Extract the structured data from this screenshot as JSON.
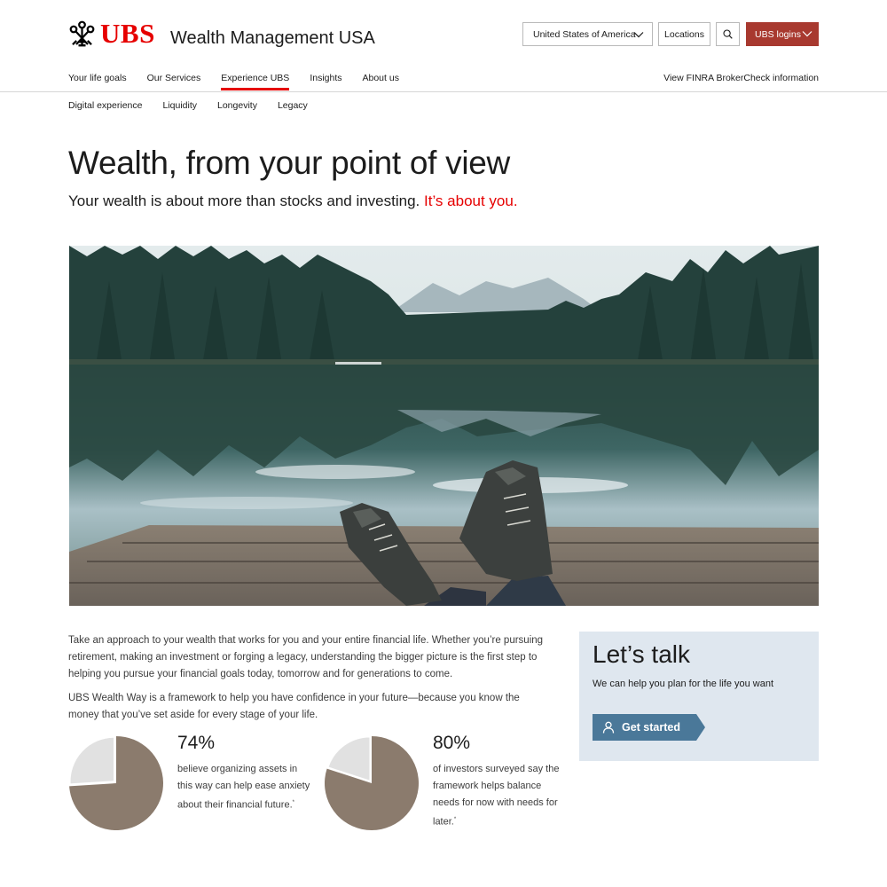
{
  "header": {
    "brand": "UBS",
    "site_title": "Wealth Management USA",
    "country_select": "United States of America",
    "locations_label": "Locations",
    "logins_label": "UBS logins",
    "search_icon": "search-icon"
  },
  "main_nav": {
    "items": [
      "Your life goals",
      "Our Services",
      "Experience UBS",
      "Insights",
      "About us"
    ],
    "active": "Experience UBS",
    "finra_link": "View FINRA BrokerCheck information"
  },
  "sub_nav": {
    "items": [
      "Digital experience",
      "Liquidity",
      "Longevity",
      "Legacy"
    ]
  },
  "hero": {
    "title": "Wealth, from your point of view",
    "subtitle": "Your wealth is about more than stocks and investing.",
    "subtitle_accent": "It’s about you."
  },
  "intro": {
    "paragraph_1": "Take an approach to your wealth that works for you and your entire financial life. Whether you’re pursuing retirement, making an investment or forging a legacy, understanding the bigger picture is the first step to helping you pursue your financial goals today, tomorrow and for generations to come.",
    "paragraph_2": "UBS Wealth Way is a framework to help you have confidence in your future—because you know the money that you’ve set aside for every stage of your life."
  },
  "stats": [
    {
      "value": 74,
      "label": "74%",
      "text": "believe organizing assets in this way can help ease anxiety about their financial future.",
      "footnote": "*"
    },
    {
      "value": 80,
      "label": "80%",
      "text": "of investors surveyed say the framework helps balance needs for now with needs for later.",
      "footnote": "*"
    }
  ],
  "cta": {
    "title": "Let’s talk",
    "subtitle": "We can help you plan for the life you want",
    "button_label": "Get started"
  },
  "colors": {
    "brand_red": "#e60000",
    "logins_bg": "#a8392f",
    "pie_fill": "#8b7b6d",
    "pie_rest": "#e1e1e1",
    "cta_bg": "#dfe7ef",
    "button_bg": "#4a7899"
  }
}
